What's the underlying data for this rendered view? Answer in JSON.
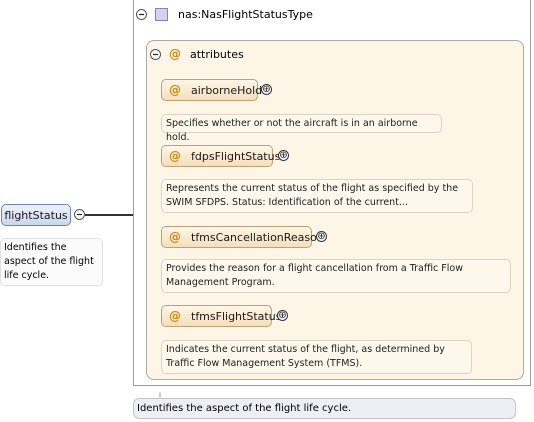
{
  "type": {
    "name": "nas:NasFlightStatusType"
  },
  "attributes_group": {
    "label": "attributes"
  },
  "attributes": [
    {
      "name": "airborneHold",
      "doc": "Specifies whether or not the aircraft is in an airborne hold."
    },
    {
      "name": "fdpsFlightStatus",
      "doc": "Represents the current status of the flight as specified by the SWIM SFDPS. Status: Identification of the current..."
    },
    {
      "name": "tfmsCancellationReason",
      "doc": "Provides the reason for a flight cancellation from a Traffic Flow Management Program."
    },
    {
      "name": "tfmsFlightStatus",
      "doc": "Indicates the current status of the flight, as determined by Traffic Flow Management System (TFMS)."
    }
  ],
  "element": {
    "name": "flightStatus",
    "doc": "Identifies the aspect of the flight life cycle."
  },
  "bottom_doc": "Identifies the aspect of the flight life cycle.",
  "icons": {
    "collapse": "⊖",
    "expand": "⊕",
    "attribute": "@"
  },
  "colors": {
    "attr_accent": "#d48a10",
    "element_border": "#6b86b4",
    "group_bg": "#fdf5e6"
  }
}
